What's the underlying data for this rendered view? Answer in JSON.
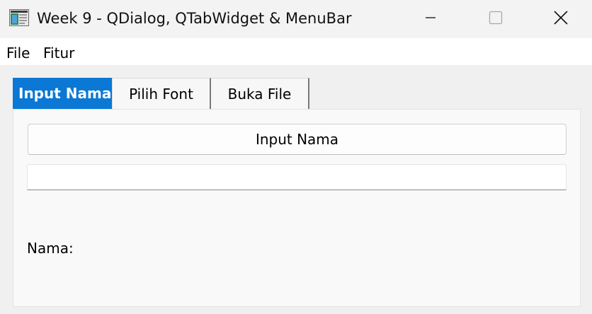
{
  "window": {
    "title": "Week 9 - QDialog, QTabWidget & MenuBar",
    "controls": {
      "minimize": "minimize-icon",
      "maximize": "maximize-icon",
      "close": "close-icon"
    }
  },
  "menubar": {
    "items": [
      {
        "label": "File"
      },
      {
        "label": "Fitur"
      }
    ]
  },
  "tabs": [
    {
      "label": "Input Nama",
      "active": true
    },
    {
      "label": "Pilih Font",
      "active": false
    },
    {
      "label": "Buka File",
      "active": false
    }
  ],
  "input_tab": {
    "button_label": "Input Nama",
    "line_edit_value": "",
    "result_label": "Nama:"
  },
  "colors": {
    "active_tab": "#0a78d4",
    "window_bg": "#f0f0f0"
  }
}
